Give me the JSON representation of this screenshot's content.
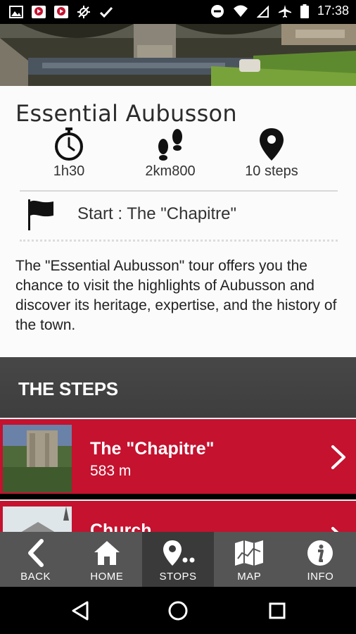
{
  "status_bar": {
    "time": "17:38",
    "icons": [
      "gallery-icon",
      "youtube-icon",
      "youtube-icon",
      "no-gps-icon",
      "check-icon",
      "dnd-icon",
      "wifi-icon",
      "no-signal-icon",
      "airplane-icon",
      "battery-icon"
    ]
  },
  "tour": {
    "title": "Essential Aubusson",
    "duration": "1h30",
    "distance": "2km800",
    "steps_count": "10 steps",
    "start": "Start : The \"Chapitre\"",
    "description": "The \"Essential Aubusson\" tour offers you the chance to visit the highlights of Aubusson and discover its heritage, expertise, and the history of the town."
  },
  "steps_section": {
    "title": "THE STEPS",
    "items": [
      {
        "name": "The \"Chapitre\"",
        "distance": "583 m"
      },
      {
        "name": "Church",
        "distance": ""
      }
    ]
  },
  "bottom_nav": {
    "items": [
      {
        "label": "BACK",
        "icon": "back-arrow-icon"
      },
      {
        "label": "HOME",
        "icon": "home-icon"
      },
      {
        "label": "STOPS",
        "icon": "stops-pin-icon"
      },
      {
        "label": "MAP",
        "icon": "map-icon"
      },
      {
        "label": "INFO",
        "icon": "info-icon"
      }
    ],
    "active": "STOPS"
  },
  "colors": {
    "accent_red": "#c4122f",
    "header_dark": "#444444",
    "nav_bg": "#555555"
  }
}
